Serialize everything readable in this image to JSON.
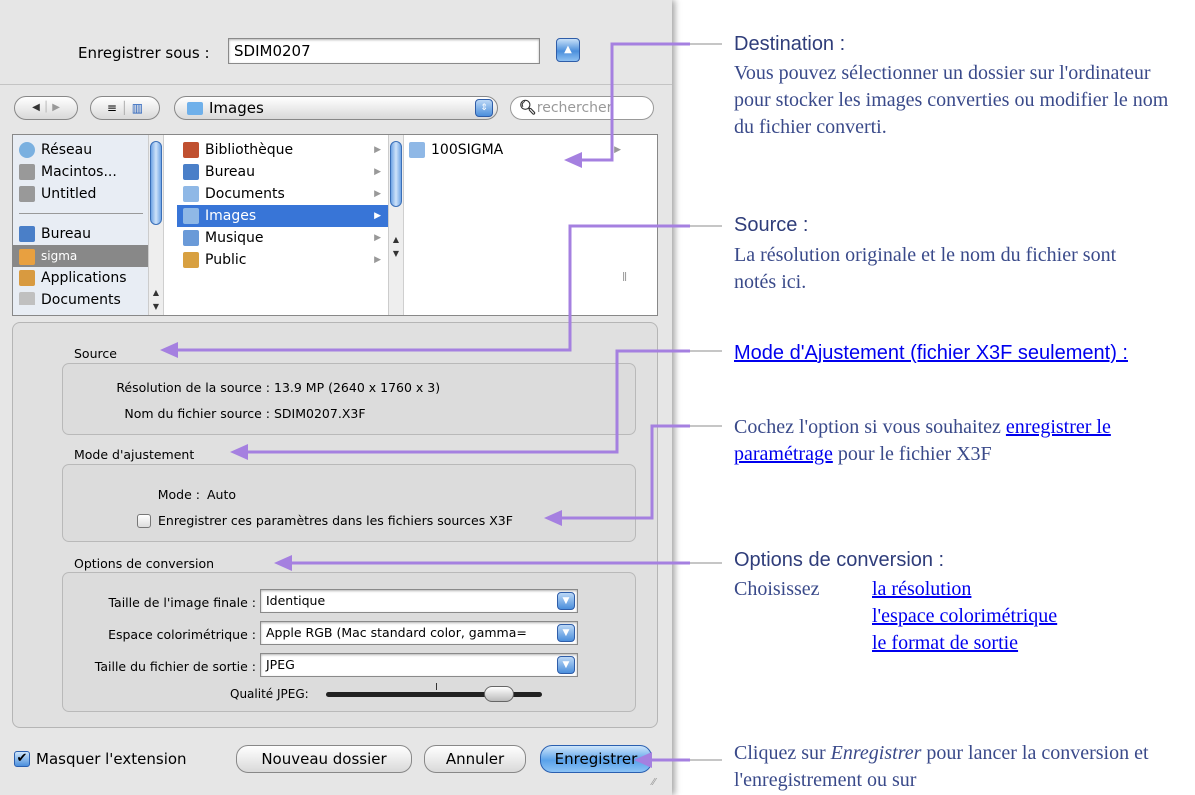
{
  "save_as": {
    "label": "Enregistrer sous :",
    "value": "SDIM0207",
    "expand_icon": "triangle-up-icon"
  },
  "browser": {
    "back_icon": "triangle-left-icon",
    "forward_icon": "triangle-right-icon",
    "list_view_icon": "list-icon",
    "column_view_icon": "columns-icon",
    "location": "Images",
    "search_placeholder": "rechercher",
    "sidebar": [
      {
        "label": "Réseau",
        "icon": "globe-icon"
      },
      {
        "label": "Macintos...",
        "icon": "disk-icon"
      },
      {
        "label": "Untitled",
        "icon": "disk-icon"
      },
      {
        "label": "Bureau",
        "icon": "desktop-icon"
      },
      {
        "label": "sigma",
        "icon": "home-icon"
      },
      {
        "label": "Applications",
        "icon": "applications-icon"
      },
      {
        "label": "Documents",
        "icon": "folder-icon"
      }
    ],
    "column1": [
      {
        "label": "Bibliothèque"
      },
      {
        "label": "Bureau"
      },
      {
        "label": "Documents"
      },
      {
        "label": "Images"
      },
      {
        "label": "Musique"
      },
      {
        "label": "Public"
      }
    ],
    "column2": [
      {
        "label": "100SIGMA"
      }
    ]
  },
  "source_group": {
    "title": "Source",
    "resolution_label": "Résolution de la source :",
    "resolution_value": "13.9 MP (2640 x 1760 x 3)",
    "filename_label": "Nom du fichier source :",
    "filename_value": "SDIM0207.X3F"
  },
  "adjust_group": {
    "title": "Mode d'ajustement",
    "mode_label": "Mode :",
    "mode_value": "Auto",
    "checkbox_label": "Enregistrer ces paramètres dans les fichiers sources X3F",
    "checkbox_checked": false
  },
  "conversion_group": {
    "title": "Options de conversion",
    "size_label": "Taille de l'image finale :",
    "size_value": "Identique",
    "colorspace_label": "Espace colorimétrique :",
    "colorspace_value": "Apple RGB (Mac standard color, gamma=",
    "output_label": "Taille du fichier de sortie :",
    "output_value": "JPEG",
    "quality_label": "Qualité JPEG:"
  },
  "bottom": {
    "hide_extension_label": "Masquer l'extension",
    "hide_extension_checked": true,
    "new_folder": "Nouveau dossier",
    "cancel": "Annuler",
    "save": "Enregistrer"
  },
  "annotations": {
    "destination_title": "Destination :",
    "destination_text": "Vous pouvez sélectionner un dossier sur l'ordinateur pour stocker les images converties ou modifier le nom du fichier converti.",
    "source_title": "Source :",
    "source_text": "La résolution originale et le nom du fichier sont notés ici.",
    "mode_link": "Mode d'Ajustement (fichier X3F seulement) :",
    "mode_text_before": "Cochez l'option si vous souhaitez",
    "mode_text_link": "enregistrer le paramétrage",
    "mode_text_after": "pour le fichier X3F",
    "options_title": "Options de conversion :",
    "options_choose": "Choisissez",
    "options_link1": "la résolution",
    "options_link2": "l'espace colorimétrique",
    "options_link3": "le format de sortie",
    "save_text_before": "Cliquez sur",
    "save_text_em": "Enregistrer",
    "save_text_after": "pour lancer la conversion et l'enregistrement ou sur"
  },
  "colors": {
    "arrow": "#a580e0",
    "selection": "#3875d7",
    "annotation_text": "#3a4a8a",
    "link": "#0000ee"
  }
}
